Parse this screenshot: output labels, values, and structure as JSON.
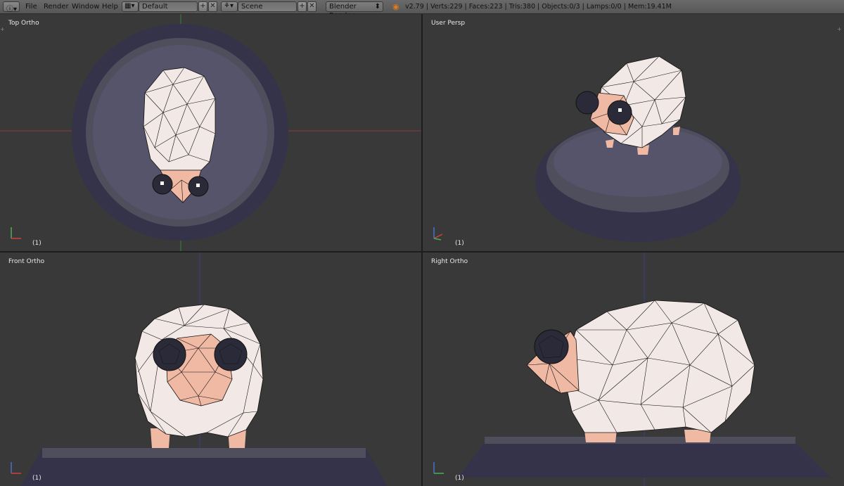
{
  "header": {
    "editor_icon": "info-editor-icon",
    "menus": [
      "File",
      "Render",
      "Window",
      "Help"
    ],
    "screen_layout": {
      "icon": "screen-layout-icon",
      "value": "Default"
    },
    "scene": {
      "icon": "scene-icon",
      "value": "Scene"
    },
    "render_engine": "Blender Render",
    "stats": "v2.79 | Verts:229 | Faces:223 | Tris:380 | Objects:0/3 | Lamps:0/0 | Mem:19.41M"
  },
  "viewports": [
    {
      "id": "top",
      "label": "Top Ortho",
      "frame": "(1)"
    },
    {
      "id": "user",
      "label": "User Persp",
      "frame": "(1)"
    },
    {
      "id": "front",
      "label": "Front Ortho",
      "frame": "(1)"
    },
    {
      "id": "right",
      "label": "Right Ortho",
      "frame": "(1)"
    }
  ],
  "colors": {
    "viewport_bg": "#393939",
    "grid_x_axis": "#8a3a3a",
    "grid_y_axis": "#3f7a3f",
    "grid_z_axis": "#3c3c8a",
    "wool": "#f2e9e7",
    "skin": "#f0b9a4",
    "eye": "#2a2a38",
    "base": "#4f4e5c",
    "base_dark": "#34334a"
  }
}
